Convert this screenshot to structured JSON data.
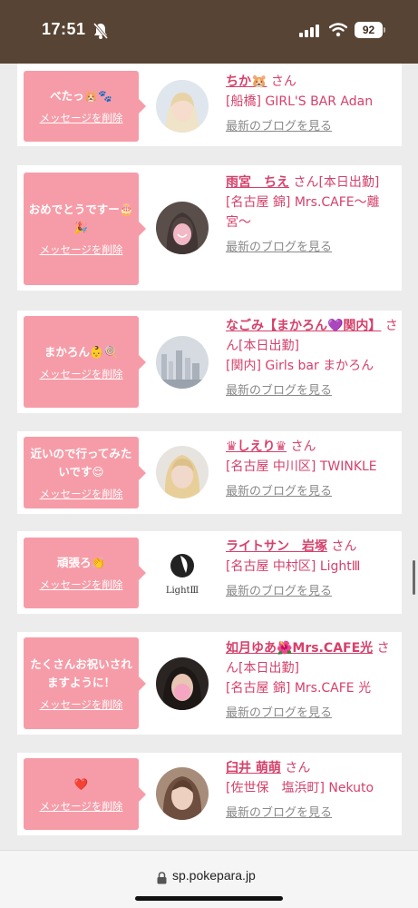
{
  "status_bar": {
    "time": "17:51",
    "battery": "92"
  },
  "url_bar": {
    "url": "sp.pokepara.jp"
  },
  "common": {
    "delete_label": "メッセージを削除",
    "blog_label": "最新のブログを見る",
    "san": "さん"
  },
  "messages": [
    {
      "message": "べたっ🐹🐾",
      "name": "ちか🐹",
      "status": "",
      "shop": "[船橋] GIRL'S BAR Adan"
    },
    {
      "message": "おめでとうですー🎂🎉",
      "name": "雨宮　ちえ",
      "status": "[本日出勤]",
      "shop": "[名古屋 錦] Mrs.CAFE〜離宮〜"
    },
    {
      "message": "まかろん👶🍭",
      "name": "なごみ【まかろん💜関内】",
      "status": "[本日出勤]",
      "shop": "[関内] Girls bar まかろん"
    },
    {
      "message": "近いので行ってみたいです😌",
      "name": "♛しえり♛",
      "status": "",
      "shop": "[名古屋 中川区] TWINKLE"
    },
    {
      "message": "頑張ろ👏",
      "name": "ライトサン　岩塚",
      "status": "",
      "shop": "[名古屋 中村区] LightⅢ"
    },
    {
      "message": "たくさんお祝いされますように！",
      "name": "如月ゆあ🌺Mrs.CAFE光",
      "status": "[本日出勤]",
      "shop": "[名古屋 錦] Mrs.CAFE 光"
    },
    {
      "message": "❤️",
      "name": "臼井 萌萌",
      "status": "",
      "shop": "[佐世保　塩浜町] Nekuto"
    }
  ],
  "logo_light": {
    "text": "LightⅢ"
  }
}
